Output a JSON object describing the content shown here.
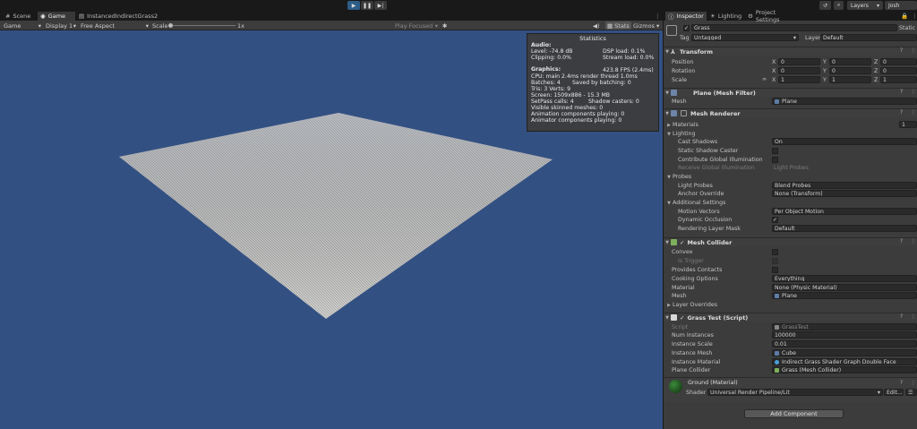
{
  "toolbar": {
    "play_icon": "play-icon",
    "pause_icon": "pause-icon",
    "step_icon": "step-icon",
    "layers_label": "Layers",
    "layout_label": "Josh"
  },
  "left_tabs": [
    "Scene",
    "Game",
    "InstancedIndirectGrass2"
  ],
  "game_bar": {
    "mode": "Game",
    "display": "Display 1",
    "aspect": "Free Aspect",
    "scale_label": "Scale",
    "scale_value": "1x",
    "play_focused": "Play Focused",
    "stats_label": "Stats",
    "gizmos_label": "Gizmos"
  },
  "stats": {
    "title": "Statistics",
    "audio_title": "Audio:",
    "level": "Level: -74.8 dB",
    "dsp": "DSP load: 0.1%",
    "clipping": "Clipping: 0.0%",
    "stream": "Stream load: 0.0%",
    "graphics_title": "Graphics:",
    "fps": "423.8 FPS (2.4ms)",
    "cpu": "CPU: main 2.4ms  render thread 1.0ms",
    "batches": "Batches: 4",
    "saved": "Saved by batching: 0",
    "tris": "Tris: 3   Verts: 9",
    "screen": "Screen: 1509x886 - 15.3 MB",
    "setpass": "SetPass calls: 4",
    "shadow": "Shadow casters: 0",
    "skinned": "Visible skinned meshes: 0",
    "anim": "Animation components playing: 0",
    "animator": "Animator components playing: 0"
  },
  "inspector": {
    "tabs": [
      "Inspector",
      "Lighting",
      "Project Settings"
    ],
    "object_name": "Grass",
    "static_label": "Static",
    "tag_label": "Tag",
    "tag_value": "Untagged",
    "layer_label": "Layer",
    "layer_value": "Default",
    "transform": {
      "title": "Transform",
      "position": "Position",
      "rotation": "Rotation",
      "scale": "Scale",
      "x": "X",
      "y": "Y",
      "z": "Z",
      "pos": [
        "0",
        "0",
        "0"
      ],
      "rot": [
        "0",
        "0",
        "0"
      ],
      "scl": [
        "1",
        "1",
        "1"
      ]
    },
    "mesh_filter": {
      "title": "Plane (Mesh Filter)",
      "mesh_label": "Mesh",
      "mesh_value": "Plane"
    },
    "mesh_renderer": {
      "title": "Mesh Renderer",
      "materials_label": "Materials",
      "materials_count": "1",
      "lighting": "Lighting",
      "cast_shadows": "Cast Shadows",
      "cast_shadows_value": "On",
      "static_shadow": "Static Shadow Caster",
      "contribute_gi": "Contribute Global Illumination",
      "receive_gi": "Receive Global Illumination",
      "receive_gi_value": "Light Probes",
      "probes": "Probes",
      "light_probes": "Light Probes",
      "light_probes_value": "Blend Probes",
      "anchor_override": "Anchor Override",
      "anchor_value": "None (Transform)",
      "additional": "Additional Settings",
      "motion_vectors": "Motion Vectors",
      "motion_value": "Per Object Motion",
      "dynamic_occlusion": "Dynamic Occlusion",
      "rendering_layer": "Rendering Layer Mask",
      "rendering_value": "Default"
    },
    "mesh_collider": {
      "title": "Mesh Collider",
      "convex": "Convex",
      "is_trigger": "Is Trigger",
      "provides_contacts": "Provides Contacts",
      "cooking": "Cooking Options",
      "cooking_value": "Everything",
      "material": "Material",
      "material_value": "None (Physic Material)",
      "mesh": "Mesh",
      "mesh_value": "Plane",
      "layer_overrides": "Layer Overrides"
    },
    "grass_test": {
      "title": "Grass Test (Script)",
      "script": "Script",
      "script_value": "GrassTest",
      "num_instances": "Num Instances",
      "num_value": "100000",
      "instance_scale": "Instance Scale",
      "scale_value": "0.01",
      "instance_mesh": "Instance Mesh",
      "mesh_value": "Cube",
      "instance_material": "Instance Material",
      "material_value": "Indirect Grass Shader Graph Double Face",
      "plane_collider": "Plane Collider",
      "collider_value": "Grass (Mesh Collider)"
    },
    "material": {
      "title": "Ground (Material)",
      "shader_label": "Shader",
      "shader_value": "Universal Render Pipeline/Lit",
      "edit_label": "Edit..."
    },
    "add_component": "Add Component"
  }
}
